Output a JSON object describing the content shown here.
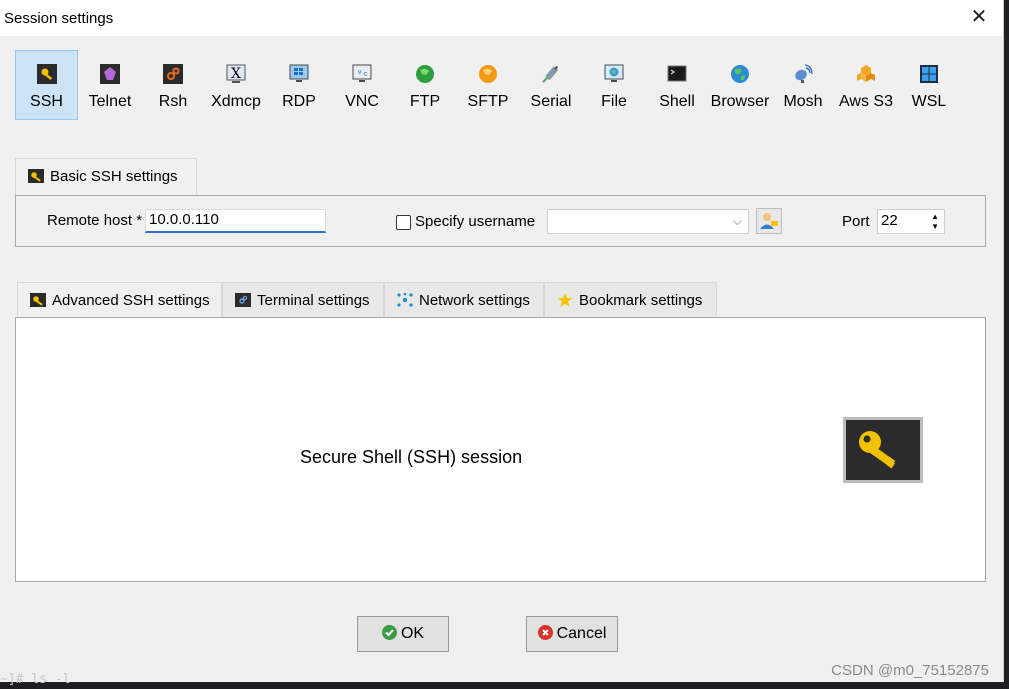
{
  "window": {
    "title": "Session settings"
  },
  "session_types": [
    {
      "label": "SSH",
      "icon": "key-icon",
      "active": true
    },
    {
      "label": "Telnet",
      "icon": "telnet-icon"
    },
    {
      "label": "Rsh",
      "icon": "rsh-icon"
    },
    {
      "label": "Xdmcp",
      "icon": "xdmcp-icon"
    },
    {
      "label": "RDP",
      "icon": "rdp-icon"
    },
    {
      "label": "VNC",
      "icon": "vnc-icon"
    },
    {
      "label": "FTP",
      "icon": "ftp-icon"
    },
    {
      "label": "SFTP",
      "icon": "sftp-icon"
    },
    {
      "label": "Serial",
      "icon": "serial-icon"
    },
    {
      "label": "File",
      "icon": "file-icon"
    },
    {
      "label": "Shell",
      "icon": "shell-icon"
    },
    {
      "label": "Browser",
      "icon": "globe-icon"
    },
    {
      "label": "Mosh",
      "icon": "satellite-icon"
    },
    {
      "label": "Aws S3",
      "icon": "aws-icon"
    },
    {
      "label": "WSL",
      "icon": "windows-icon"
    }
  ],
  "basic": {
    "tab_label": "Basic SSH settings",
    "remote_host_label": "Remote host *",
    "remote_host_value": "10.0.0.110",
    "specify_username_label": "Specify username",
    "specify_username_checked": false,
    "username_value": "",
    "port_label": "Port",
    "port_value": "22"
  },
  "advanced_tabs": [
    {
      "label": "Advanced SSH settings",
      "icon": "key-icon"
    },
    {
      "label": "Terminal settings",
      "icon": "terminal-icon"
    },
    {
      "label": "Network settings",
      "icon": "network-icon"
    },
    {
      "label": "Bookmark settings",
      "icon": "star-icon"
    }
  ],
  "panel": {
    "description": "Secure Shell (SSH) session"
  },
  "buttons": {
    "ok": "OK",
    "cancel": "Cancel"
  },
  "watermark": "CSDN @m0_75152875",
  "background_terminal": "~]# ls -l",
  "colors": {
    "accent": "#2e6fcf",
    "active_tab": "#cde4f7",
    "key_gold": "#f2c200"
  }
}
